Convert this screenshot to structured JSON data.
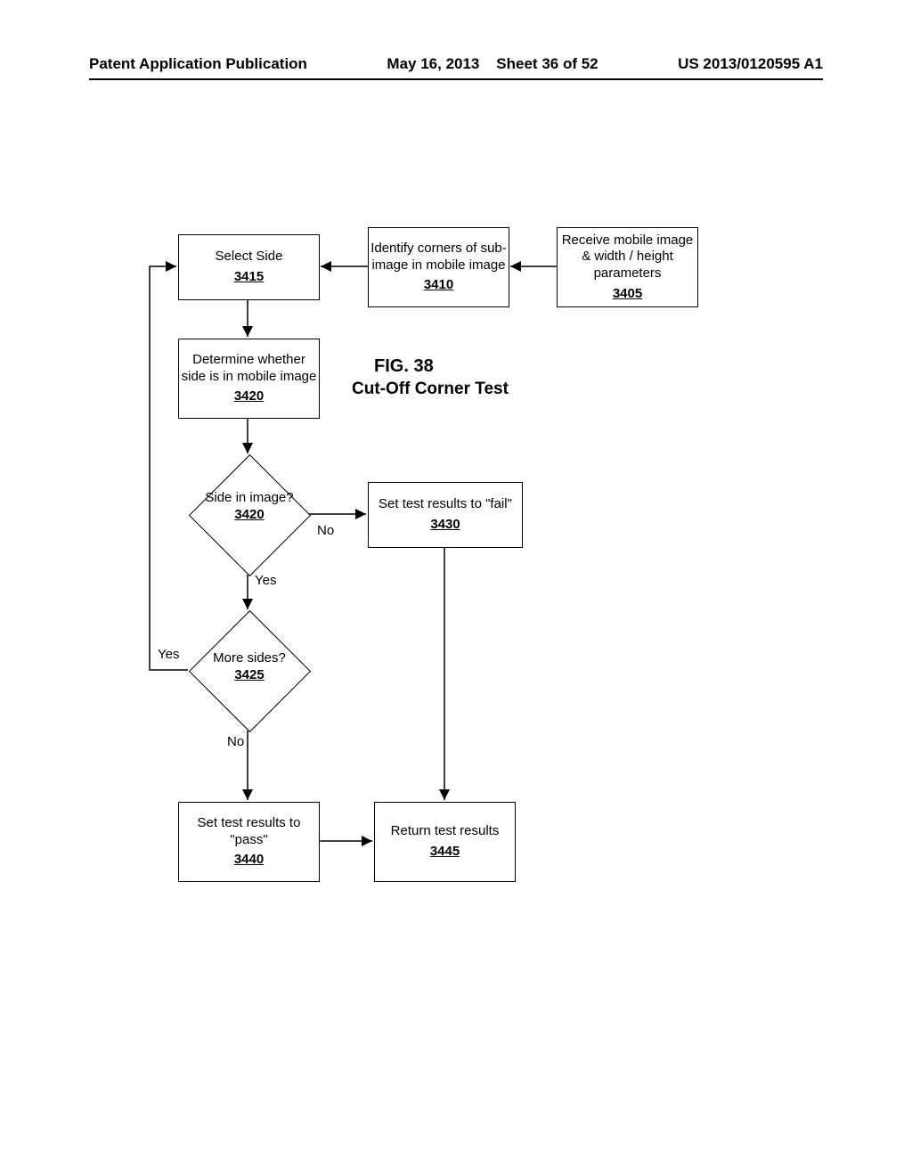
{
  "header": {
    "pubType": "Patent Application Publication",
    "date": "May 16, 2013",
    "sheet": "Sheet 36 of 52",
    "pubNum": "US 2013/0120595 A1"
  },
  "figure": {
    "number": "FIG. 38",
    "title": "Cut-Off Corner Test"
  },
  "nodes": {
    "n3405": {
      "text": "Receive mobile image & width / height parameters",
      "ref": "3405"
    },
    "n3410": {
      "text": "Identify corners of sub-image in mobile image",
      "ref": "3410"
    },
    "n3415": {
      "text": "Select Side",
      "ref": "3415"
    },
    "n3420a": {
      "text": "Determine whether side is in mobile image",
      "ref": "3420"
    },
    "n3420b": {
      "text": "Side in image?",
      "ref": "3420"
    },
    "n3425": {
      "text": "More sides?",
      "ref": "3425"
    },
    "n3430": {
      "text": "Set test results to \"fail\"",
      "ref": "3430"
    },
    "n3440": {
      "text": "Set test results to \"pass\"",
      "ref": "3440"
    },
    "n3445": {
      "text": "Return test results",
      "ref": "3445"
    }
  },
  "labels": {
    "yes": "Yes",
    "no": "No"
  }
}
